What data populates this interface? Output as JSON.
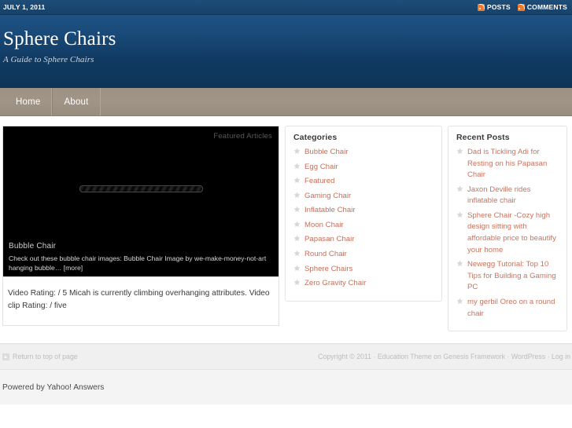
{
  "topbar": {
    "date": "JULY 1, 2011",
    "posts_label": "POSTS",
    "comments_label": "COMMENTS"
  },
  "header": {
    "site_title": "Sphere Chairs",
    "site_description": "A Guide to Sphere Chairs"
  },
  "nav": {
    "items": [
      {
        "label": "Home"
      },
      {
        "label": "About"
      }
    ]
  },
  "featured": {
    "heading": "Featured Articles",
    "post_title": "Bubble Chair",
    "excerpt": "Check out these bubble chair images: Bubble Chair Image by we-make-money-not-art hanging bubble…",
    "more_label": "[more]"
  },
  "main_text": {
    "paragraph": "Video Rating: / 5 Micah is currently climbing overhanging attributes. Video clip Rating: / five"
  },
  "categories": {
    "title": "Categories",
    "items": [
      {
        "label": "Bubble Chair"
      },
      {
        "label": "Egg Chair"
      },
      {
        "label": "Featured"
      },
      {
        "label": "Gaming Chair"
      },
      {
        "label": "Inflatable Chair"
      },
      {
        "label": "Moon Chair"
      },
      {
        "label": "Papasan Chair"
      },
      {
        "label": "Round Chair"
      },
      {
        "label": "Sphere Chairs"
      },
      {
        "label": "Zero Gravity Chair"
      }
    ]
  },
  "recent_posts": {
    "title": "Recent Posts",
    "items": [
      {
        "label": "Dad is Tickling Adi for Resting on his Papasan Chair"
      },
      {
        "label": "Jaxon Deville rides inflatable chair"
      },
      {
        "label": "Sphere Chair -Cozy high design sitting with affordable price to beautify your home"
      },
      {
        "label": "Newegg Tutorial: Top 10 Tips for Building a Gaming PC"
      },
      {
        "label": "my gerbil Oreo on a round chair"
      }
    ]
  },
  "footer": {
    "return_top": "Return to top of page",
    "copyright": "Copyright © 2011 · Education Theme on Genesis Framework · WordPress · Log in"
  },
  "bottom": {
    "powered_by": "Powered by Yahoo! Answers"
  },
  "colors": {
    "header_blue": "#16406b",
    "nav_tan": "#9d9184",
    "link_red": "#c4705c",
    "rss_orange": "#f07a28"
  }
}
